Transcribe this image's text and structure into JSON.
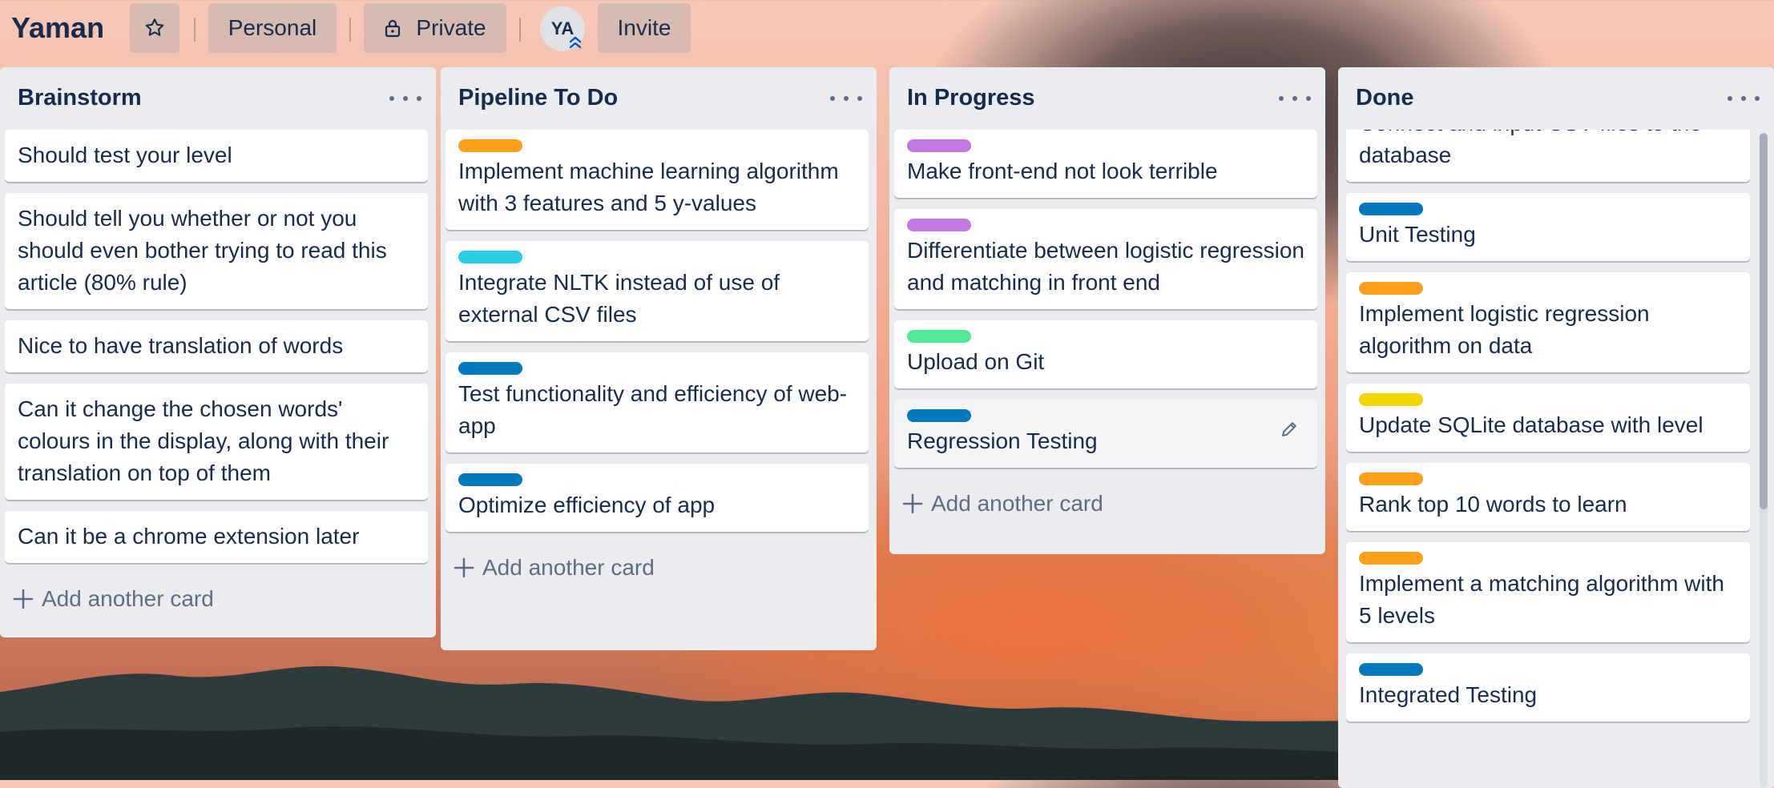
{
  "board": {
    "title": "Yaman"
  },
  "header": {
    "visibility_team": "Personal",
    "visibility_privacy": "Private",
    "avatar_initials": "YA",
    "invite_label": "Invite"
  },
  "add_card_label": "Add another card",
  "label_colors": {
    "orange": "#ff9f1a",
    "sky": "#29cce5",
    "blue": "#0079bf",
    "purple": "#c377e0",
    "green": "#61bd4f",
    "lime": "#51e898",
    "yellow": "#f2d600"
  },
  "lists": [
    {
      "title": "Brainstorm",
      "cards": [
        {
          "text": "Should test your level"
        },
        {
          "text": "Should tell you whether or not you should even bother trying to read this article (80% rule)"
        },
        {
          "text": "Nice to have translation of words"
        },
        {
          "text": "Can it change the chosen words' colours in the display, along with their translation on top of them"
        },
        {
          "text": "Can it be a chrome extension later"
        }
      ]
    },
    {
      "title": "Pipeline To Do",
      "cards": [
        {
          "label": "orange",
          "text": "Implement machine learning algorithm with 3 features and 5 y-values"
        },
        {
          "label": "sky",
          "text": "Integrate NLTK instead of use of external CSV files"
        },
        {
          "label": "blue",
          "text": "Test functionality and efficiency of web-app"
        },
        {
          "label": "blue",
          "text": "Optimize efficiency of app"
        }
      ]
    },
    {
      "title": "In Progress",
      "cards": [
        {
          "label": "purple",
          "text": "Make front-end not look terrible"
        },
        {
          "label": "purple",
          "text": "Differentiate between logistic regression and matching in front end"
        },
        {
          "label": "lime",
          "text": "Upload on Git"
        },
        {
          "label": "blue",
          "text": "Regression Testing"
        }
      ]
    },
    {
      "title": "Done",
      "cards": [
        {
          "text": "Connect and input CSV files to the database"
        },
        {
          "label": "blue",
          "text": "Unit Testing"
        },
        {
          "label": "orange",
          "text": "Implement logistic regression algorithm on data"
        },
        {
          "label": "yellow",
          "text": "Update SQLite database with level"
        },
        {
          "label": "orange",
          "text": "Rank top 10 words to learn"
        },
        {
          "label": "orange",
          "text": "Implement a matching algorithm with 5 levels"
        },
        {
          "label": "blue",
          "text": "Integrated Testing"
        }
      ]
    }
  ]
}
